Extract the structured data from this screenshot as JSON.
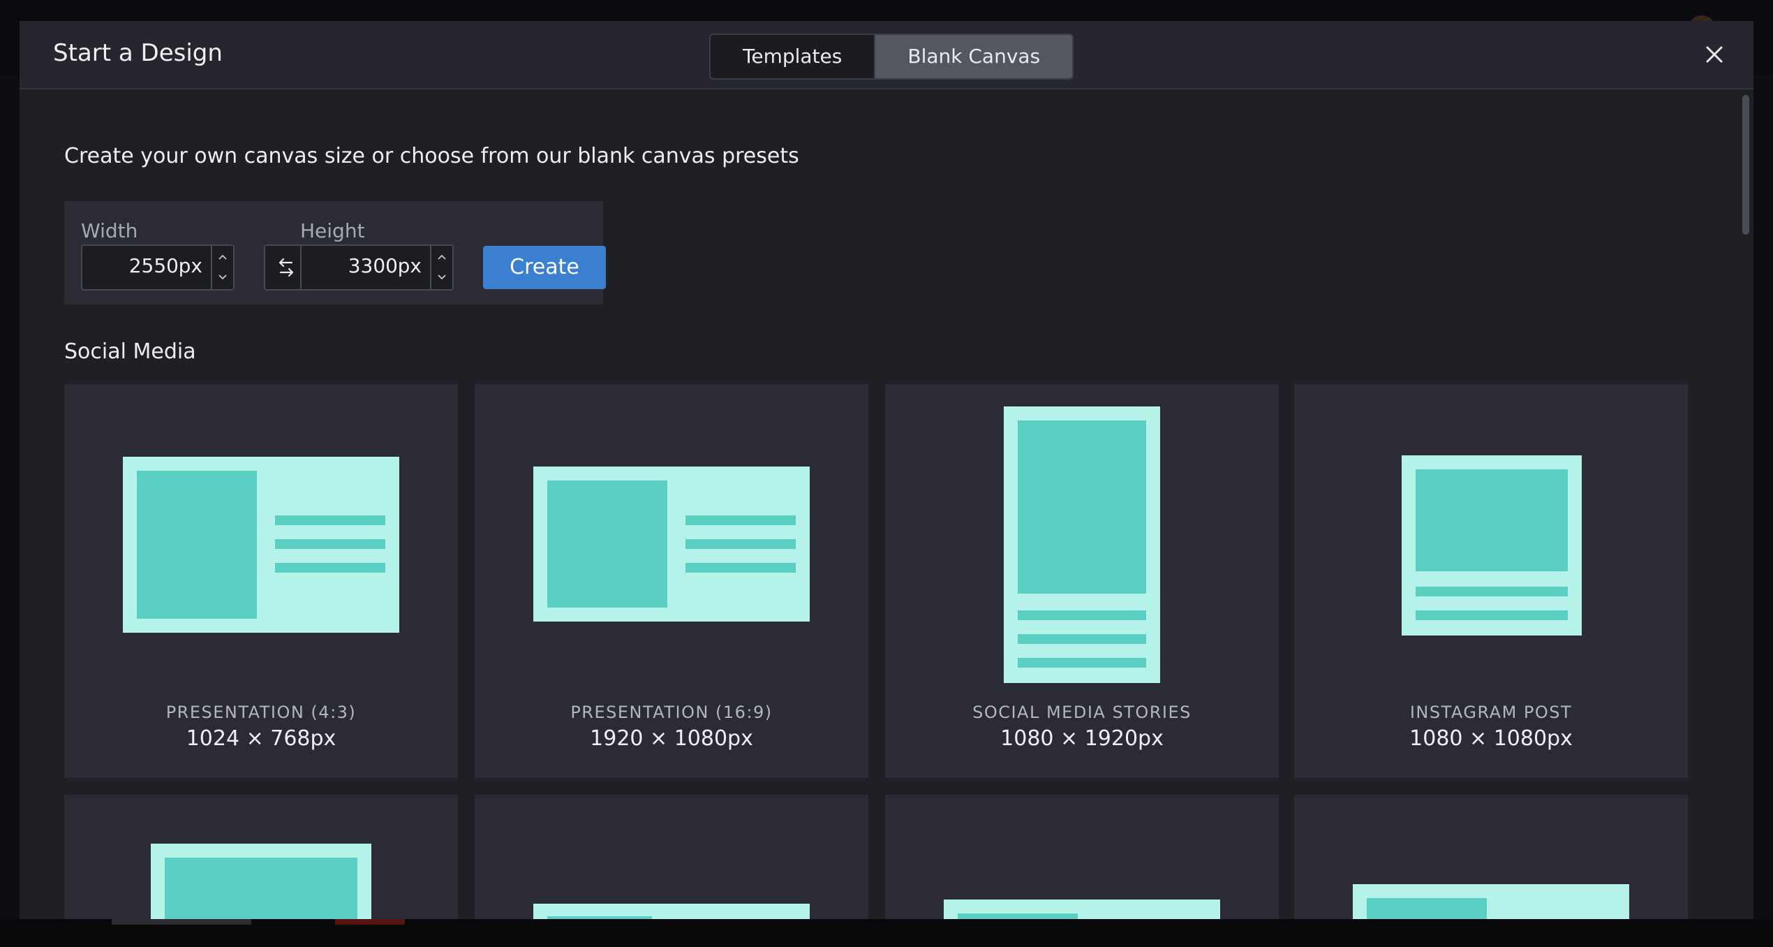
{
  "modal": {
    "title": "Start a Design",
    "tabs": [
      {
        "label": "Templates",
        "active": false
      },
      {
        "label": "Blank Canvas",
        "active": true
      }
    ]
  },
  "intro_text": "Create your own canvas size or choose from our blank canvas presets",
  "size_form": {
    "width_label": "Width",
    "width_value": "2550",
    "height_label": "Height",
    "height_value": "3300",
    "unit": "px",
    "create_label": "Create"
  },
  "section": {
    "title": "Social Media"
  },
  "presets": [
    {
      "name": "PRESENTATION (4:3)",
      "size": "1024 × 768px"
    },
    {
      "name": "PRESENTATION (16:9)",
      "size": "1920 × 1080px"
    },
    {
      "name": "SOCIAL MEDIA STORIES",
      "size": "1080 × 1920px"
    },
    {
      "name": "INSTAGRAM POST",
      "size": "1080 × 1080px"
    }
  ],
  "colors": {
    "accent": "#3b7fd0",
    "thumb_light": "#b4f2ea",
    "thumb_dark": "#5acec2",
    "card_bg": "#2a2b34"
  },
  "icons": [
    "close-icon",
    "swap-icon",
    "chevron-up-icon",
    "chevron-down-icon"
  ]
}
